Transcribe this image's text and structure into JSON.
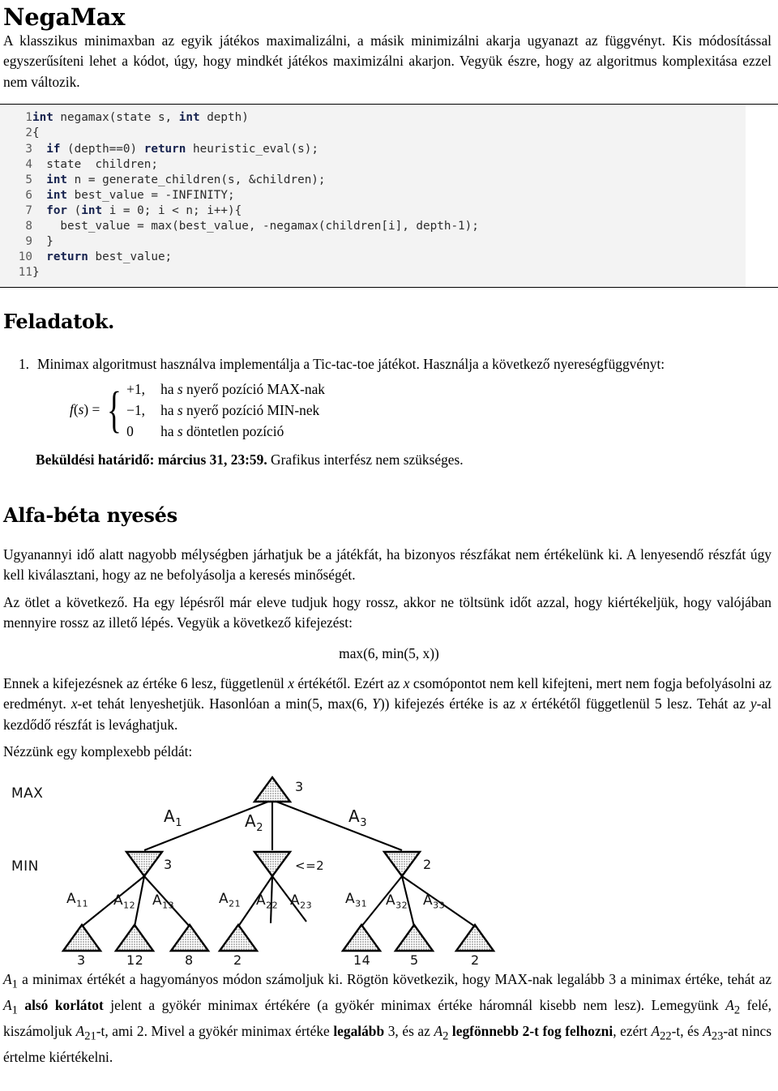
{
  "document": {
    "title": "NegaMax",
    "intro_paragraph": "A klasszikus minimaxban az egyik játékos maximalizálni, a másik minimizálni akarja ugyanazt az függvényt. Kis módosítással egyszerűsíteni lehet a kódot, úgy, hogy mindkét játékos maximizálni akarjon. Vegyük észre, hogy az algoritmus komplexitása ezzel nem változik."
  },
  "code": {
    "language": "c",
    "lines": [
      {
        "n": "1",
        "segments": [
          {
            "t": "int",
            "kw": true
          },
          {
            "t": " negamax(state s, ",
            "kw": false
          },
          {
            "t": "int",
            "kw": true
          },
          {
            "t": " depth)",
            "kw": false
          }
        ]
      },
      {
        "n": "2",
        "segments": [
          {
            "t": "{",
            "kw": false
          }
        ]
      },
      {
        "n": "3",
        "segments": [
          {
            "t": "  ",
            "kw": false
          },
          {
            "t": "if",
            "kw": true
          },
          {
            "t": " (depth==0) ",
            "kw": false
          },
          {
            "t": "return",
            "kw": true
          },
          {
            "t": " heuristic_eval(s);",
            "kw": false
          }
        ]
      },
      {
        "n": "4",
        "segments": [
          {
            "t": "  state  children;",
            "kw": false
          }
        ]
      },
      {
        "n": "5",
        "segments": [
          {
            "t": "  ",
            "kw": false
          },
          {
            "t": "int",
            "kw": true
          },
          {
            "t": " n = generate_children(s, &children);",
            "kw": false
          }
        ]
      },
      {
        "n": "6",
        "segments": [
          {
            "t": "  ",
            "kw": false
          },
          {
            "t": "int",
            "kw": true
          },
          {
            "t": " best_value = -INFINITY;",
            "kw": false
          }
        ]
      },
      {
        "n": "7",
        "segments": [
          {
            "t": "  ",
            "kw": false
          },
          {
            "t": "for",
            "kw": true
          },
          {
            "t": " (",
            "kw": false
          },
          {
            "t": "int",
            "kw": true
          },
          {
            "t": " i = 0; i < n; i++){",
            "kw": false
          }
        ]
      },
      {
        "n": "8",
        "segments": [
          {
            "t": "    best_value = max(best_value, -negamax(children[i], depth-1);",
            "kw": false
          }
        ]
      },
      {
        "n": "9",
        "segments": [
          {
            "t": "  }",
            "kw": false
          }
        ]
      },
      {
        "n": "10",
        "segments": [
          {
            "t": "  ",
            "kw": false
          },
          {
            "t": "return",
            "kw": true
          },
          {
            "t": " best_value;",
            "kw": false
          }
        ]
      },
      {
        "n": "11",
        "segments": [
          {
            "t": "}",
            "kw": false
          }
        ]
      }
    ]
  },
  "tasks_section": {
    "heading": "Feladatok.",
    "items": [
      {
        "number": "1.",
        "text": "Minimax algoritmust használva implementálja a Tic-tac-toe játékot. Használja a következő nyereségfüggvényt:"
      }
    ],
    "formula": {
      "lhs_f": "f",
      "lhs_arg": "s",
      "cases": [
        {
          "value": "+1,",
          "condition_pre": "ha ",
          "condition_var": "s",
          "condition_post": " nyerő pozíció MAX-nak"
        },
        {
          "value": "−1,",
          "condition_pre": "ha ",
          "condition_var": "s",
          "condition_post": " nyerő pozíció MIN-nek"
        },
        {
          "value": "0",
          "condition_pre": "ha ",
          "condition_var": "s",
          "condition_post": " döntetlen pozíció"
        }
      ]
    },
    "deadline_bold": "Beküldési határidő: március 31, 23:59.",
    "deadline_rest": " Grafikus interfész nem szükséges."
  },
  "alphabeta_section": {
    "heading": "Alfa-béta nyesés",
    "paragraph1": "Ugyanannyi idő alatt nagyobb mélységben járhatjuk be a játékfát, ha bizonyos részfákat nem értékelünk ki. A lenyesendő részfát úgy kell kiválasztani, hogy az ne befolyásolja a keresés minőségét.",
    "paragraph2": "Az ötlet a következő. Ha egy lépésről már eleve tudjuk hogy rossz, akkor ne töltsünk időt azzal, hogy kiértékeljük, hogy valójában mennyire rossz az illető lépés. Vegyük a következő kifejezést:",
    "display_math": "max(6, min(5, x))",
    "paragraph3_parts": {
      "a": "Ennek a kifejezésnek az értéke 6 lesz, függetlenül ",
      "x1": "x",
      "b": " értékétől. Ezért az ",
      "x2": "x",
      "c": " csomópontot nem kell kifejteni, mert nem fogja befolyásolni az eredményt. ",
      "x3": "x",
      "d": "-et tehát lenyeshetjük. Hasonlóan a min(5, max(6, ",
      "Y": "Y",
      "e": ")) kifejezés értéke is az ",
      "x4": "x",
      "f": " értékétől függetlenül 5 lesz. Tehát az ",
      "y1": "y",
      "g": "-al kezdődő részfát is levághatjuk."
    },
    "paragraph4": "Nézzünk egy komplexebb példát:"
  },
  "tree_figure": {
    "row_labels": {
      "max": "MAX",
      "min": "MIN"
    },
    "root": {
      "label": "3",
      "type": "max-triangle"
    },
    "root_edge_labels": [
      {
        "base": "A",
        "sub": "1"
      },
      {
        "base": "A",
        "sub": "2"
      },
      {
        "base": "A",
        "sub": "3"
      }
    ],
    "min_nodes": [
      {
        "label": "3"
      },
      {
        "label": "<=2"
      },
      {
        "label": "2"
      }
    ],
    "leaf_edge_labels": [
      {
        "base": "A",
        "sub": "11"
      },
      {
        "base": "A",
        "sub": "12"
      },
      {
        "base": "A",
        "sub": "13"
      },
      {
        "base": "A",
        "sub": "21"
      },
      {
        "base": "A",
        "sub": "22"
      },
      {
        "base": "A",
        "sub": "23"
      },
      {
        "base": "A",
        "sub": "31"
      },
      {
        "base": "A",
        "sub": "32"
      },
      {
        "base": "A",
        "sub": "33"
      }
    ],
    "leaf_values": [
      "3",
      "12",
      "8",
      "2",
      "14",
      "5",
      "2"
    ]
  },
  "closing_paragraph": {
    "p1": "A",
    "p1sub": "1",
    "p2": " a minimax értékét a hagyományos módon számoljuk ki.  Rögtön következik, hogy MAX-nak legalább 3 a minimax értéke, tehát az ",
    "p3": "A",
    "p3sub": "1",
    "bold1": " alsó korlátot",
    "p4": " jelent a gyökér minimax értékére (a gyökér minimax értéke háromnál kisebb nem lesz). Lemegyünk ",
    "p5": "A",
    "p5sub": "2",
    "p6": " felé, kiszámoljuk ",
    "p7": "A",
    "p7sub": "21",
    "p8": "-t, ami 2. Mivel a gyökér minimax értéke ",
    "bold2": "legalább",
    "p9": " 3, és az ",
    "p10": "A",
    "p10sub": "2",
    "bold3": " legfönnebb 2-t fog felhozni",
    "p11": ", ezért ",
    "p12": "A",
    "p12sub": "22",
    "p13": "-t, és ",
    "p14": "A",
    "p14sub": "23",
    "p15": "-at nincs értelme kiértékelni."
  },
  "colors": {
    "code_background": "#f3f3f3",
    "code_keyword": "#16224e",
    "code_text": "#2b2b2b",
    "line_number": "#5a5a5a",
    "rule": "#000000",
    "node_fill": "#d9d9d9"
  }
}
